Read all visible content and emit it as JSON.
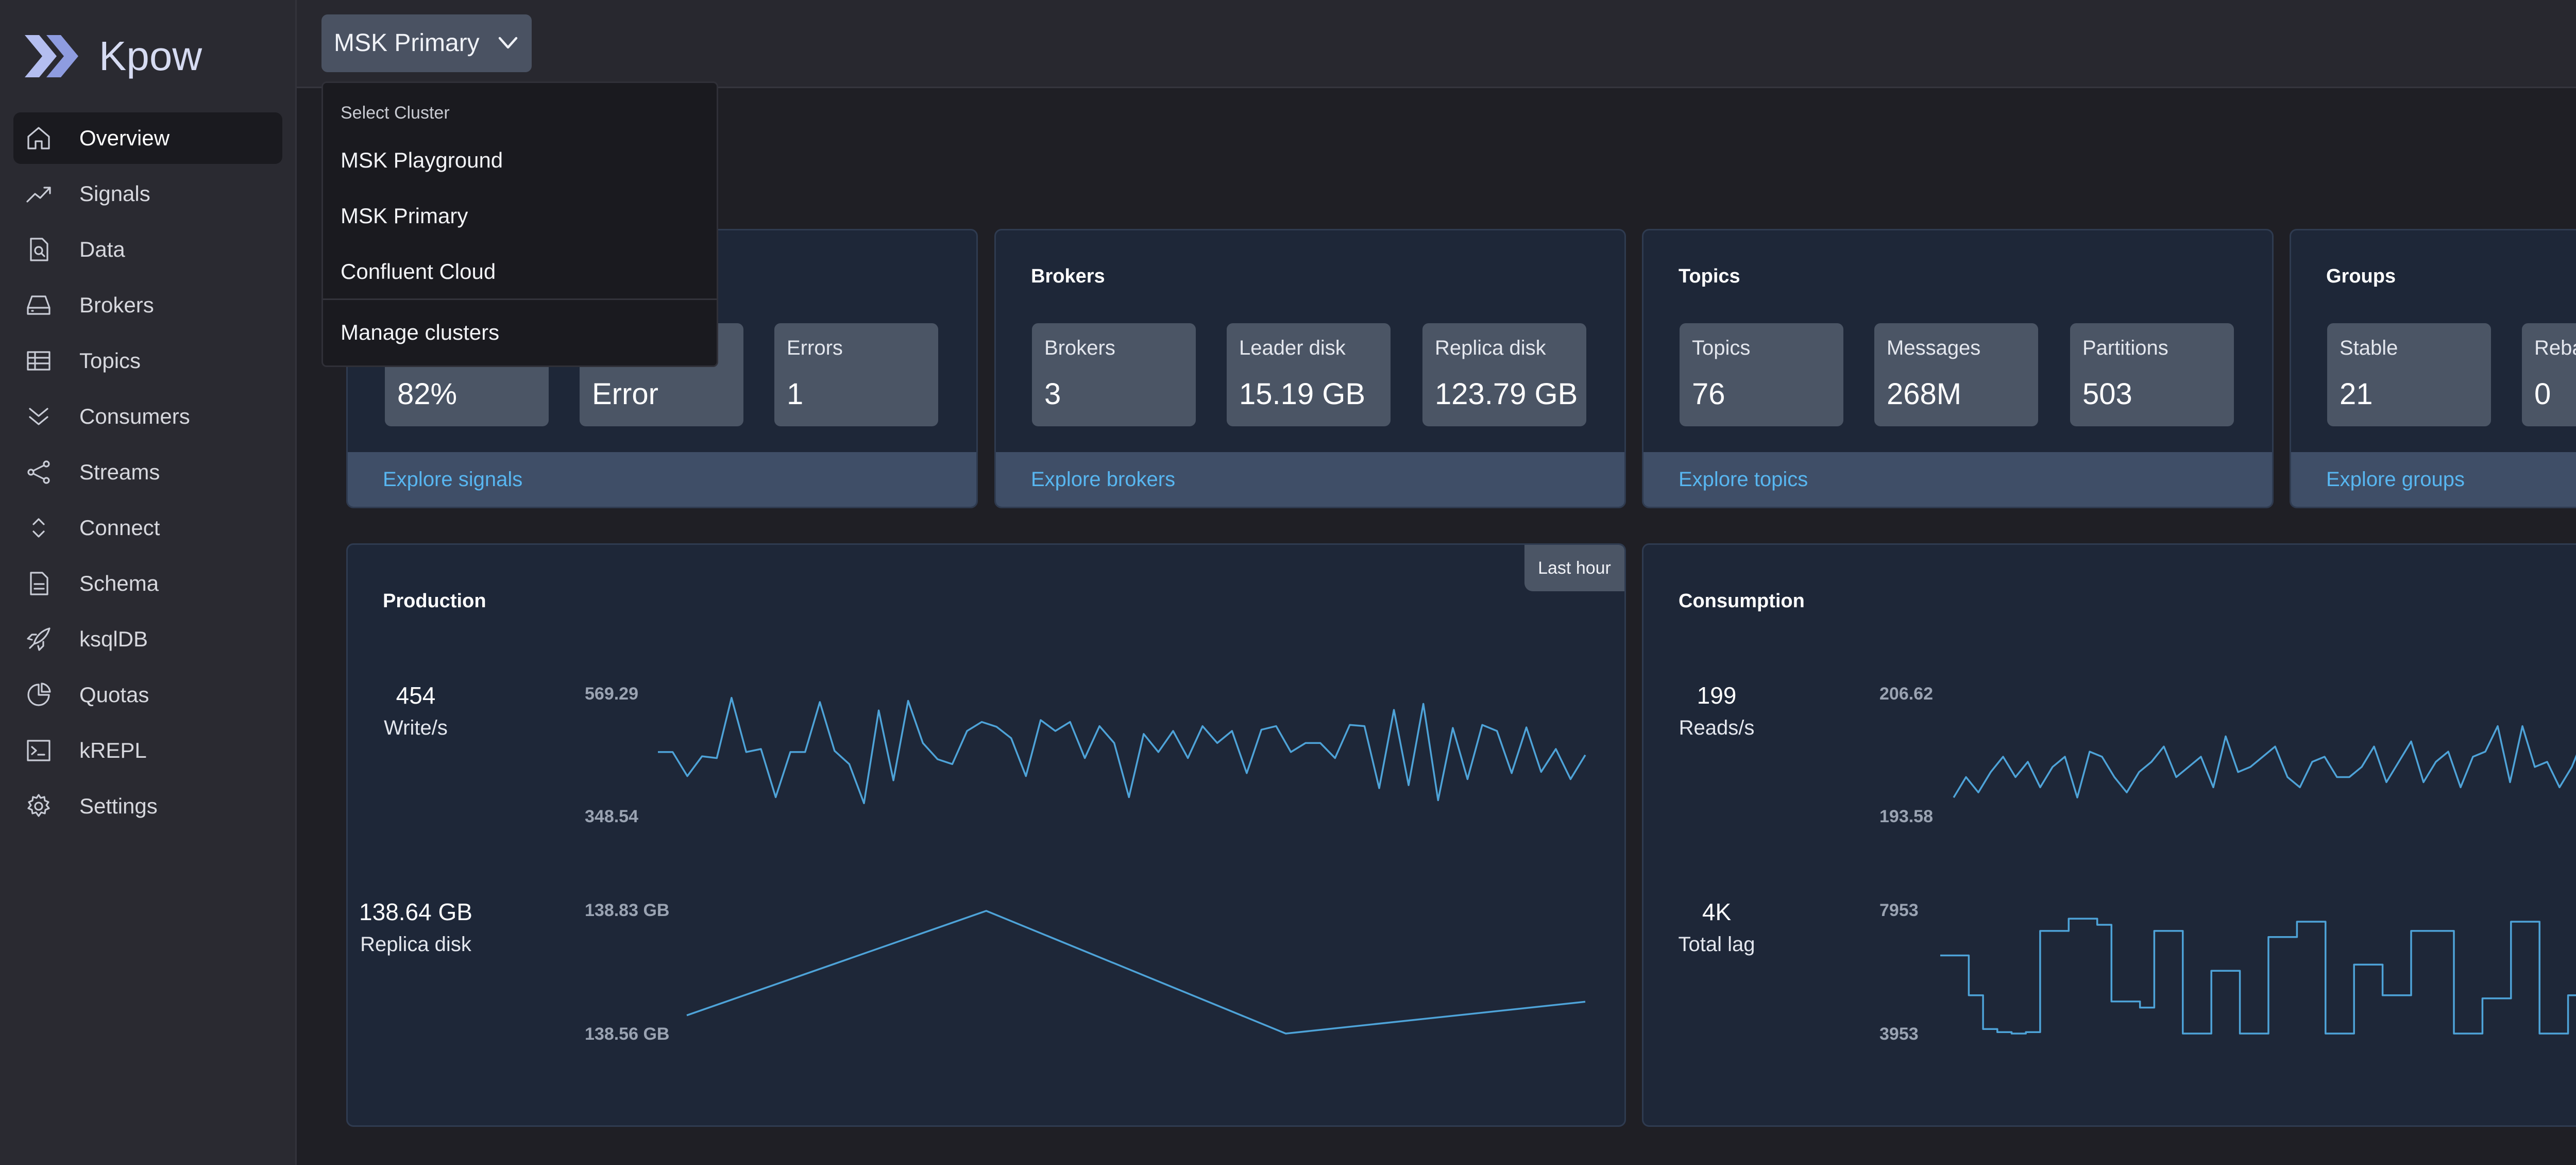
{
  "app": {
    "name": "Kpow"
  },
  "sidebar": {
    "items": [
      {
        "label": "Overview",
        "icon": "home-icon",
        "active": true
      },
      {
        "label": "Signals",
        "icon": "trending-up-icon"
      },
      {
        "label": "Data",
        "icon": "file-search-icon"
      },
      {
        "label": "Brokers",
        "icon": "hard-drive-icon"
      },
      {
        "label": "Topics",
        "icon": "table-icon"
      },
      {
        "label": "Consumers",
        "icon": "chevrons-down-icon"
      },
      {
        "label": "Streams",
        "icon": "share-icon"
      },
      {
        "label": "Connect",
        "icon": "chevron-up-down-icon"
      },
      {
        "label": "Schema",
        "icon": "file-text-icon"
      },
      {
        "label": "ksqlDB",
        "icon": "rocket-icon"
      },
      {
        "label": "Quotas",
        "icon": "pie-chart-icon"
      },
      {
        "label": "kREPL",
        "icon": "terminal-icon"
      },
      {
        "label": "Settings",
        "icon": "gear-icon"
      }
    ]
  },
  "cluster_selector": {
    "current": "MSK Primary",
    "dropdown": {
      "header": "Select Cluster",
      "options": [
        "MSK Playground",
        "MSK Primary",
        "Confluent Cloud"
      ],
      "manage": "Manage clusters"
    }
  },
  "cards": {
    "signals": {
      "boxes": [
        {
          "key": "",
          "value": "82%"
        },
        {
          "key": "",
          "value": "Error"
        },
        {
          "key": "Errors",
          "value": "1"
        }
      ],
      "footer": "Explore signals"
    },
    "brokers": {
      "title": "Brokers",
      "boxes": [
        {
          "key": "Brokers",
          "value": "3"
        },
        {
          "key": "Leader disk",
          "value": "15.19 GB"
        },
        {
          "key": "Replica disk",
          "value": "123.79 GB"
        }
      ],
      "footer": "Explore brokers"
    },
    "topics": {
      "title": "Topics",
      "boxes": [
        {
          "key": "Topics",
          "value": "76"
        },
        {
          "key": "Messages",
          "value": "268M"
        },
        {
          "key": "Partitions",
          "value": "503"
        }
      ],
      "footer": "Explore topics"
    },
    "groups": {
      "title": "Groups",
      "boxes": [
        {
          "key": "Stable",
          "value": "21"
        },
        {
          "key": "Reba",
          "value": "0"
        }
      ],
      "footer": "Explore groups"
    }
  },
  "production": {
    "title": "Production",
    "range_badge": "Last hour",
    "writes": {
      "value": "454",
      "unit": "Write/s",
      "max": "569.29",
      "min": "348.54"
    },
    "replica": {
      "value": "138.64 GB",
      "unit": "Replica disk",
      "max": "138.83 GB",
      "min": "138.56 GB"
    }
  },
  "consumption": {
    "title": "Consumption",
    "reads": {
      "value": "199",
      "unit": "Reads/s",
      "max": "206.62",
      "min": "193.58"
    },
    "lag": {
      "value": "4K",
      "unit": "Total lag",
      "max": "7953",
      "min": "3953"
    }
  },
  "chart_data": [
    {
      "type": "line",
      "title": "Write/s",
      "ylim": [
        348.54,
        569.29
      ],
      "values": [
        465,
        465,
        425,
        458,
        455,
        555,
        465,
        470,
        390,
        465,
        465,
        548,
        467,
        445,
        380,
        534,
        418,
        550,
        480,
        453,
        445,
        500,
        515,
        507,
        488,
        425,
        518,
        500,
        515,
        455,
        508,
        480,
        390,
        495,
        465,
        500,
        455,
        508,
        480,
        500,
        430,
        502,
        508,
        465,
        480,
        480,
        455,
        510,
        508,
        405,
        535,
        410,
        545,
        385,
        505,
        420,
        510,
        500,
        430,
        506,
        432,
        470,
        420,
        460
      ]
    },
    {
      "type": "line",
      "title": "Replica disk (GB)",
      "ylim": [
        138.56,
        138.83
      ],
      "values": [
        138.6,
        138.83,
        138.56,
        138.63
      ]
    },
    {
      "type": "line",
      "title": "Reads/s",
      "ylim": [
        193.58,
        206.62
      ],
      "values": [
        196,
        198,
        196.5,
        198.5,
        200,
        198,
        199.5,
        197,
        199,
        200,
        196,
        200.5,
        200,
        198,
        196.5,
        198.5,
        199.5,
        201,
        198,
        199,
        200,
        197,
        202,
        198.5,
        199,
        200,
        201,
        198,
        197,
        199.5,
        200,
        198,
        198,
        199,
        201,
        197.5,
        199.5,
        201.5,
        197.5,
        199.5,
        200.5,
        197,
        200,
        200.5,
        203,
        197.5,
        203,
        199,
        199.5,
        197,
        199,
        202,
        199.5
      ]
    },
    {
      "type": "line",
      "title": "Total lag",
      "ylim": [
        3953,
        7953
      ],
      "values": [
        6500,
        6500,
        5200,
        4100,
        4000,
        3953,
        4000,
        7300,
        7300,
        7700,
        7700,
        7500,
        5000,
        5000,
        4800,
        7300,
        7300,
        3953,
        3953,
        6000,
        6000,
        3953,
        3953,
        7100,
        7100,
        7600,
        7600,
        3953,
        3953,
        6200,
        6200,
        5200,
        5200,
        7300,
        7300,
        7300,
        3953,
        3953,
        5100,
        5100,
        7600,
        7600,
        3953,
        3953,
        5200,
        7400,
        7400
      ]
    }
  ]
}
